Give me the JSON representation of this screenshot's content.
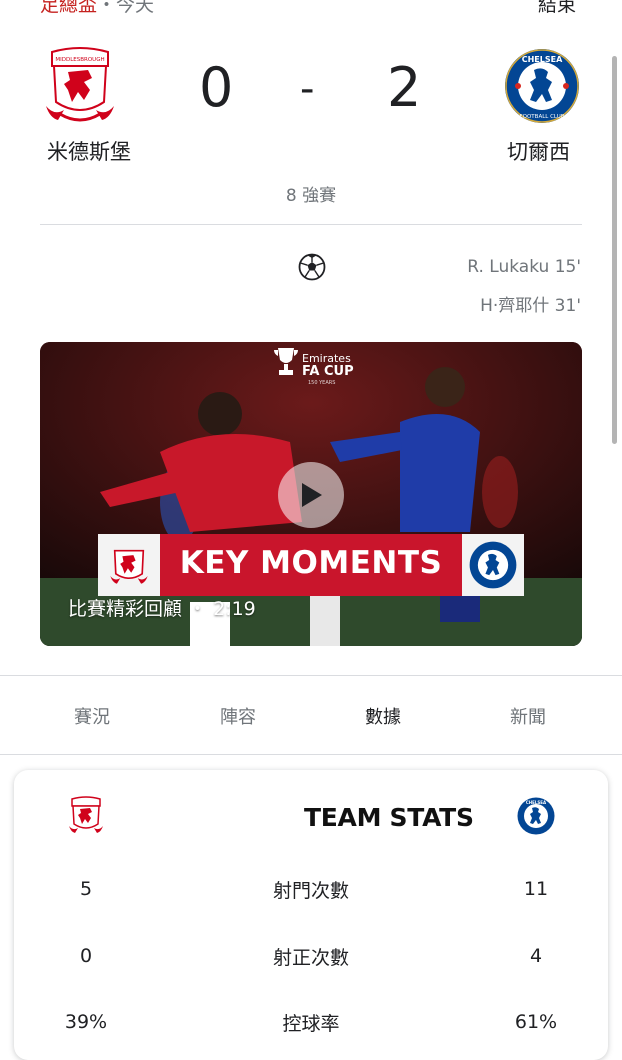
{
  "header": {
    "competition": "足總盃",
    "separator": "・",
    "day": "今天",
    "status": "結束"
  },
  "match": {
    "home": {
      "name": "米德斯堡",
      "score": "0",
      "crest_icon": "middlesbrough-crest-icon"
    },
    "away": {
      "name": "切爾西",
      "score": "2",
      "crest_icon": "chelsea-crest-icon"
    },
    "dash": "-",
    "round": "8 強賽"
  },
  "scorers": {
    "icon": "soccer-ball-icon",
    "items": [
      "R. Lukaku 15'",
      "H‧齊耶什 31'"
    ]
  },
  "video": {
    "competition_logo_line1": "Emirates",
    "competition_logo_line2": "FA CUP",
    "competition_logo_line3": "150 YEARS",
    "banner": "KEY MOMENTS",
    "caption": "比賽精彩回顧 ・ 2:19",
    "play_icon": "play-icon"
  },
  "tabs": [
    {
      "label": "賽況",
      "active": false
    },
    {
      "label": "陣容",
      "active": false
    },
    {
      "label": "數據",
      "active": true
    },
    {
      "label": "新聞",
      "active": false
    }
  ],
  "stats": {
    "title": "TEAM STATS",
    "rows": [
      {
        "home": "5",
        "label": "射門次數",
        "away": "11"
      },
      {
        "home": "0",
        "label": "射正次數",
        "away": "4"
      },
      {
        "home": "39%",
        "label": "控球率",
        "away": "61%"
      }
    ]
  },
  "colors": {
    "accent": "#c5221f",
    "middlesbrough_red": "#d0021b",
    "chelsea_blue": "#034694",
    "banner_red": "#c9152c"
  }
}
